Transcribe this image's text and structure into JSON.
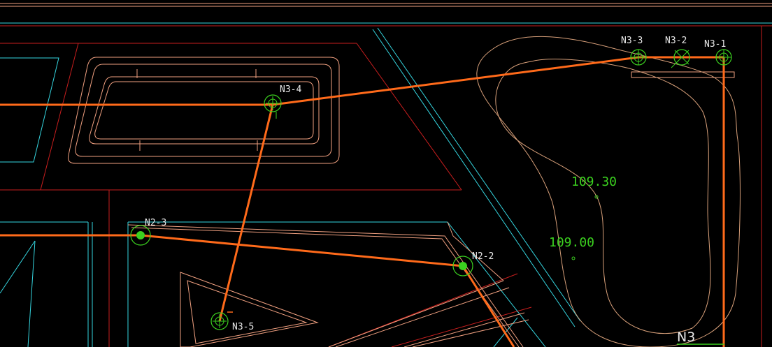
{
  "drawing": {
    "colors": {
      "background": "#000000",
      "pipe": "#ff6a1a",
      "boundary_red": "#c81e1e",
      "outline_salmon": "#f0a080",
      "curb_cyan": "#35d6e0",
      "contour": "#d8a07a",
      "node_green": "#3bd11f",
      "text": "#e8e8e8"
    },
    "nodes": [
      {
        "id": "N3-1",
        "kind": "hollow"
      },
      {
        "id": "N3-2",
        "kind": "cross"
      },
      {
        "id": "N3-3",
        "kind": "hollow"
      },
      {
        "id": "N3-4",
        "kind": "hollow"
      },
      {
        "id": "N3-5",
        "kind": "hollow"
      },
      {
        "id": "N2-3",
        "kind": "filled"
      },
      {
        "id": "N2-2",
        "kind": "filled"
      }
    ],
    "elevations": [
      "109.30",
      "109.00"
    ],
    "area_label": "N3"
  }
}
